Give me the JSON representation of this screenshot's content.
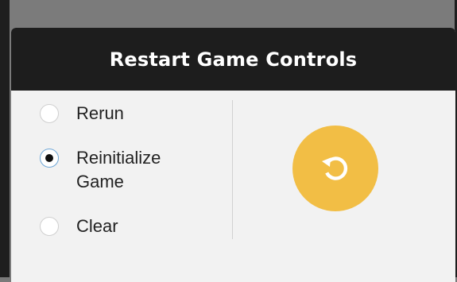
{
  "dialog": {
    "title": "Restart Game Controls",
    "options": [
      {
        "label": "Rerun",
        "selected": false
      },
      {
        "label": "Reinitialize Game",
        "selected": true
      },
      {
        "label": "Clear",
        "selected": false
      }
    ],
    "action_icon": "restart-icon",
    "colors": {
      "header": "#1d1d1d",
      "panel": "#f2f2f2",
      "button": "#f2be45",
      "radio_selected_ring": "#6ea6d6"
    }
  }
}
